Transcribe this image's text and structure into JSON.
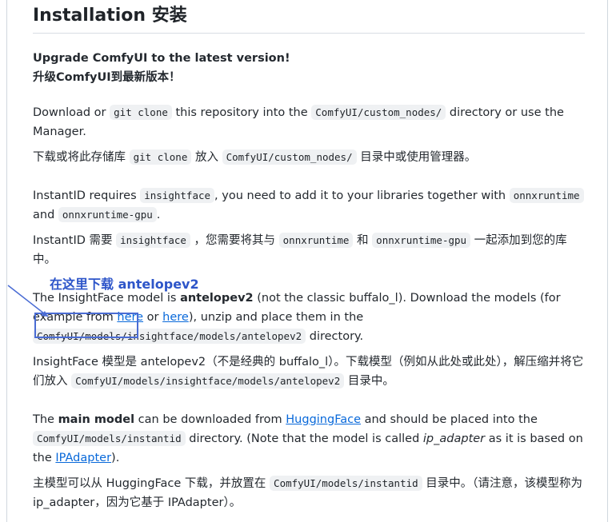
{
  "heading": "Installation 安装",
  "upgrade_en": "Upgrade ComfyUI to the latest version!",
  "upgrade_zh": "升级ComfyUI到最新版本！",
  "clone_en": {
    "t1": "Download or ",
    "code1": "git clone",
    "t2": " this repository into the ",
    "code2": "ComfyUI/custom_nodes/",
    "t3": " directory or use the Manager."
  },
  "clone_zh": {
    "t1": "下载或将此存储库 ",
    "code1": "git clone",
    "t2": " 放入 ",
    "code2": "ComfyUI/custom_nodes/",
    "t3": " 目录中或使用管理器。"
  },
  "insight_en": {
    "t1": "InstantID requires ",
    "code1": "insightface",
    "t2": ", you need to add it to your libraries together with ",
    "code2": "onnxruntime",
    "t3": " and ",
    "code3": "onnxruntime-gpu",
    "t4": "."
  },
  "insight_zh": {
    "t1": "InstantID 需要 ",
    "code1": "insightface",
    "t2": " ，您需要将其与 ",
    "code2": "onnxruntime",
    "t3": " 和 ",
    "code3": "onnxruntime-gpu",
    "t4": " 一起添加到您的库中。"
  },
  "annotation": "在这里下载 antelopev2",
  "model_en": {
    "t1": "The InsightFace model is ",
    "bold": "antelopev2",
    "t2": " (not the classic buffalo_l). Download the models (for example from ",
    "link1": "here",
    "t3": " or ",
    "link2": "here",
    "t4": "), unzip and place them in the ",
    "code1": "ComfyUI/models/insightface/models/antelopev2",
    "t5": " directory."
  },
  "model_zh": {
    "t1": "InsightFace 模型是 antelopev2（不是经典的 buffalo_l）。下载模型（例如从此处或此处），解压缩并将它们放入 ",
    "code1": "ComfyUI/models/insightface/models/antelopev2",
    "t2": " 目录中。"
  },
  "main_en": {
    "t1": "The ",
    "bold": "main model",
    "t2": " can be downloaded from ",
    "link1": "HuggingFace",
    "t3": " and should be placed into the ",
    "code1": "ComfyUI/models/instantid",
    "t4": " directory. (Note that the model is called ",
    "ital": "ip_adapter",
    "t5": " as it is based on the ",
    "link2": "IPAdapter",
    "t6": ")."
  },
  "main_zh": {
    "t1": "主模型可以从 HuggingFace 下载，并放置在 ",
    "code1": "ComfyUI/models/instantid",
    "t2": " 目录中。（请注意，该模型称为 ip_adapter，因为它基于 IPAdapter）。"
  },
  "colors": {
    "link": "#0969da",
    "annotation": "#2d55c9",
    "code_bg": "#eff1f3"
  }
}
